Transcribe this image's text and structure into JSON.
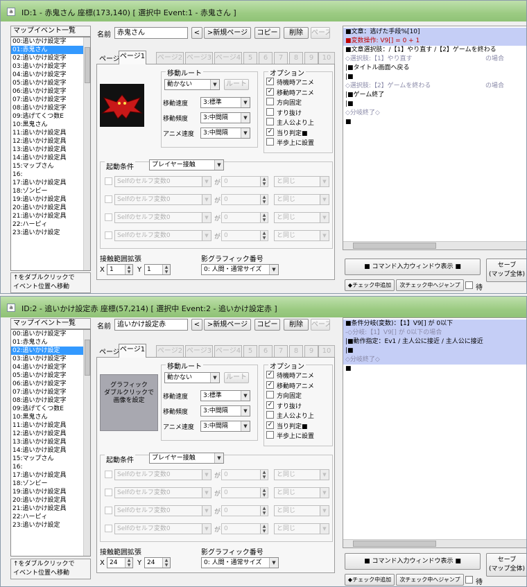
{
  "windows": [
    {
      "icon": "a",
      "title": "ID:1 - 赤鬼さん 座標(173,140) [ 選択中 Event:1 - 赤鬼さん ]",
      "list_header": "マップイベント一覧",
      "events": [
        "00:追いかけ設定字",
        "01:赤鬼さん",
        "02:追いかけ設定字",
        "03:追いかけ設定字",
        "04:追いかけ設定字",
        "05:追いかけ設定字",
        "06:追いかけ設定字",
        "07:追いかけ設定字",
        "08:追いかけ設定字",
        "09:逃げてくつ数E",
        "10:黒鬼さん",
        "11:追いかけ設定具",
        "12:追いかけ設定具",
        "13:追いかけ設定具",
        "14:追いかけ設定具",
        "15:マップさん",
        "16:",
        "17:追いかけ設定具",
        "18:ゾンビー",
        "19:追いかけ設定具",
        "20:追いかけ設定具",
        "21:追いかけ設定具",
        "22:ハーピィ",
        "23:追いかけ設定"
      ],
      "selected_index": 1,
      "hint": [
        "↑をダブルクリックで",
        "イベント位置へ移動"
      ],
      "name_label": "名前",
      "name_value": "赤鬼さん",
      "buttons": {
        "prev": "<",
        "new_page": ">新規ページ",
        "copy": "コピー",
        "delete": "削除",
        "paste": "ペースト"
      },
      "page_label": "ページ",
      "tabs": [
        "ページ1",
        "ページ2",
        "ページ3",
        "ページ4",
        "5",
        "6",
        "7",
        "8",
        "9",
        "10"
      ],
      "graphic_text": [],
      "route_title": "移動ルート",
      "route_value": "動かない",
      "route_button": "ルート",
      "speed_label": "移動速度",
      "speed_value": "3:標準",
      "freq_label": "移動頻度",
      "freq_value": "3:中間隔",
      "anim_label": "アニメ速度",
      "anim_value": "3:中間隔",
      "options_title": "オプション",
      "options": [
        {
          "label": "待機時アニメ",
          "checked": true
        },
        {
          "label": "移動時アニメ",
          "checked": true
        },
        {
          "label": "方向固定",
          "checked": false
        },
        {
          "label": "すり抜け",
          "checked": false
        },
        {
          "label": "主人公より上",
          "checked": false
        },
        {
          "label": "当り判定■",
          "checked": true
        },
        {
          "label": "半歩上に設置",
          "checked": false
        }
      ],
      "trigger_title": "起動条件",
      "trigger_value": "プレイヤー接触",
      "cond_placeholder": "Selfのセルフ変数0",
      "cond_ga": "が",
      "cond_val": "0",
      "cond_op": "と同じ",
      "range_title": "接触範囲拡張",
      "range_x_label": "X",
      "range_x": "1",
      "range_y_label": "Y",
      "range_y": "1",
      "shadow_title": "影グラフィック番号",
      "shadow_value": "0: 人間・通常サイズ",
      "commands": [
        {
          "text": "■文章：逃げた手段%[10]",
          "style": "sel"
        },
        {
          "text": "■変数操作: V9[] = 0 + 1",
          "style": "sel-red"
        },
        {
          "text": "■文章選択肢：/【1】やり直す /【2】ゲームを終わる",
          "style": "normal"
        },
        {
          "text": "◇選択肢:【1】やり直す",
          "style": "gray",
          "right": "の場合"
        },
        {
          "text": "  |■タイトル画面へ戻る",
          "style": "normal"
        },
        {
          "text": "  |■",
          "style": "normal"
        },
        {
          "text": "◇選択肢:【2】ゲームを終わる",
          "style": "gray",
          "right": "の場合"
        },
        {
          "text": "  |■ゲーム終了",
          "style": "normal"
        },
        {
          "text": "  |■",
          "style": "normal"
        },
        {
          "text": "◇分岐終了◇",
          "style": "gray"
        },
        {
          "text": "■",
          "style": "normal"
        }
      ],
      "cmd_input_button": "■ コマンド入力ウィンドウ表示 ■",
      "save_button": [
        "セーブ",
        "(マップ全体)"
      ],
      "check_add_button": "◆チェック中追加",
      "next_check_button": "次チェック中へジャンプ",
      "wait_label": "待"
    },
    {
      "icon": "a",
      "title": "ID:2 - 追いかけ設定赤 座標(57,214) [ 選択中 Event:2 - 追いかけ設定赤 ]",
      "list_header": "マップイベント一覧",
      "events": [
        "00:追いかけ設定字",
        "01:赤鬼さん",
        "02:追いかけ設定",
        "03:追いかけ設定字",
        "04:追いかけ設定字",
        "05:追いかけ設定字",
        "06:追いかけ設定字",
        "07:追いかけ設定字",
        "08:追いかけ設定字",
        "09:逃げてくつ数E",
        "10:黒鬼さん",
        "11:追いかけ設定具",
        "12:追いかけ設定具",
        "13:追いかけ設定具",
        "14:追いかけ設定具",
        "15:マップさん",
        "16:",
        "17:追いかけ設定具",
        "18:ゾンビー",
        "19:追いかけ設定具",
        "20:追いかけ設定具",
        "21:追いかけ設定具",
        "22:ハーピィ",
        "23:追いかけ設定"
      ],
      "selected_index": 2,
      "hint": [
        "↑をダブルクリックで",
        "イベント位置へ移動"
      ],
      "name_label": "名前",
      "name_value": "追いかけ設定赤",
      "buttons": {
        "prev": "<",
        "new_page": ">新規ページ",
        "copy": "コピー",
        "delete": "削除",
        "paste": "ペースト"
      },
      "page_label": "ページ",
      "tabs": [
        "ページ1",
        "ページ2",
        "ページ3",
        "ページ4",
        "5",
        "6",
        "7",
        "8",
        "9",
        "10"
      ],
      "graphic_text": [
        "グラフィック",
        "",
        "ダブルクリックで",
        "画像を設定"
      ],
      "route_title": "移動ルート",
      "route_value": "動かない",
      "route_button": "ルート",
      "speed_label": "移動速度",
      "speed_value": "3:標準",
      "freq_label": "移動頻度",
      "freq_value": "3:中間隔",
      "anim_label": "アニメ速度",
      "anim_value": "3:中間隔",
      "options_title": "オプション",
      "options": [
        {
          "label": "待機時アニメ",
          "checked": true
        },
        {
          "label": "移動時アニメ",
          "checked": true
        },
        {
          "label": "方向固定",
          "checked": false
        },
        {
          "label": "すり抜け",
          "checked": true
        },
        {
          "label": "主人公より上",
          "checked": false
        },
        {
          "label": "当り判定■",
          "checked": true
        },
        {
          "label": "半歩上に設置",
          "checked": false
        }
      ],
      "trigger_title": "起動条件",
      "trigger_value": "プレイヤー接触",
      "cond_placeholder": "Selfのセルフ変数0",
      "cond_ga": "が",
      "cond_val": "0",
      "cond_op": "と同じ",
      "range_title": "接触範囲拡張",
      "range_x_label": "X",
      "range_x": "24",
      "range_y_label": "Y",
      "range_y": "24",
      "shadow_title": "影グラフィック番号",
      "shadow_value": "0: 人間・通常サイズ",
      "commands": [
        {
          "text": "■条件分岐(変数)：【1】V9[] が 0以下",
          "style": "sel"
        },
        {
          "text": "-◇分岐:【1】V9[] が 0以下の場合",
          "style": "sel-gray"
        },
        {
          "text": "  |■動作指定：Ev1 / 主人公に接近 / 主人公に接近",
          "style": "sel"
        },
        {
          "text": "  |■",
          "style": "sel"
        },
        {
          "text": "◇分岐終了◇",
          "style": "sel-gray"
        },
        {
          "text": "■",
          "style": "normal"
        }
      ],
      "cmd_input_button": "■ コマンド入力ウィンドウ表示 ■",
      "save_button": [
        "セーブ",
        "(マップ全体)"
      ],
      "check_add_button": "◆チェック中追加",
      "next_check_button": "次チェック中へジャンプ",
      "wait_label": "待"
    }
  ]
}
